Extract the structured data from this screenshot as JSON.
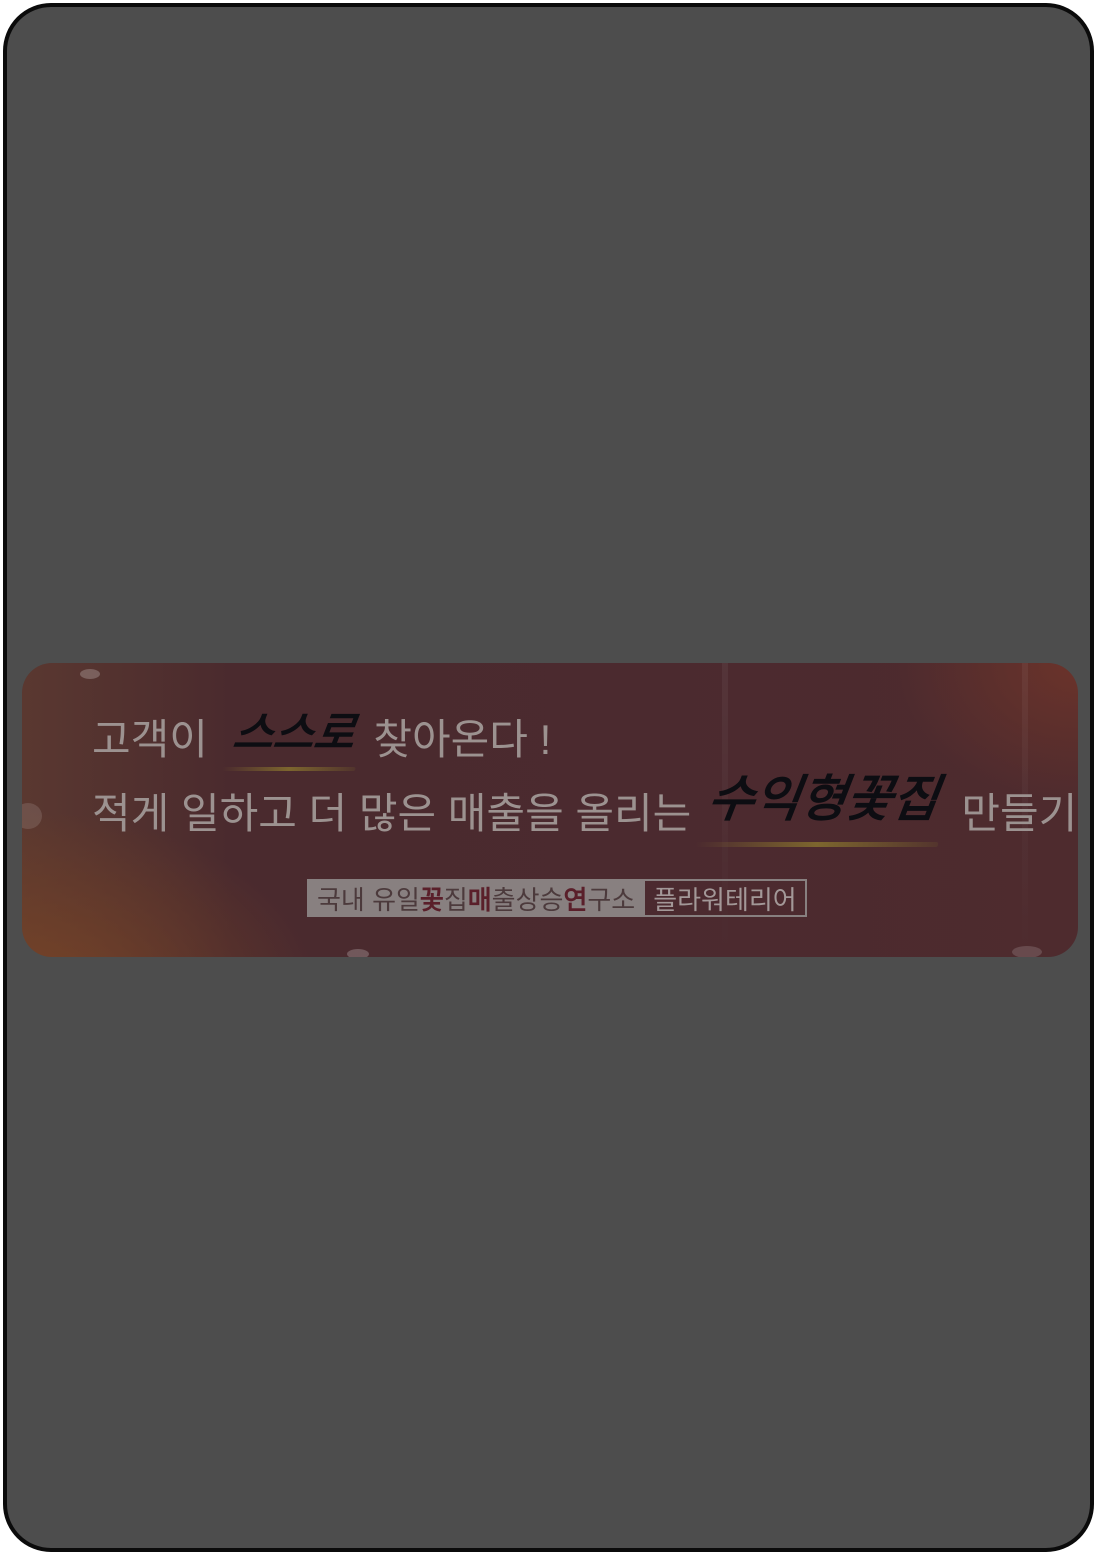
{
  "banner": {
    "line1": {
      "before": "고객이",
      "emphasis": "스스로",
      "after": "찾아온다 !"
    },
    "line2": {
      "before": "적게 일하고 더 많은 매출을 올리는",
      "emphasis": "수익형꽃집",
      "after": "만들기"
    },
    "tagline": {
      "p1": "국내 유일 ",
      "p2": "꽃",
      "p3": "집 ",
      "p4": "매",
      "p5": "출상승 ",
      "p6": "연",
      "p7": "구소",
      "brand": "플라워테리어"
    }
  },
  "colors": {
    "overlay": "#4d4d4d",
    "frame": "#0b0b0b",
    "banner": "#4b2a2f",
    "text": "#9c9290"
  }
}
